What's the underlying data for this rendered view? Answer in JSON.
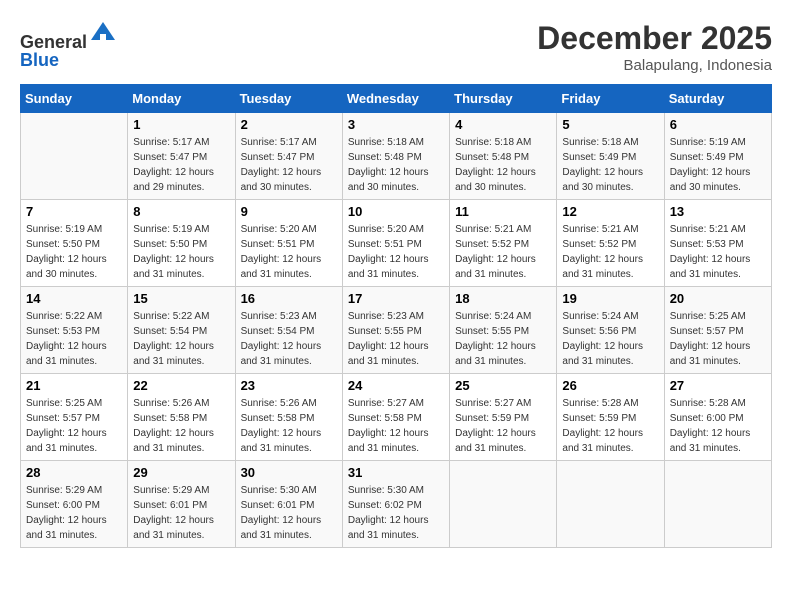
{
  "header": {
    "logo_line1": "General",
    "logo_line2": "Blue",
    "month_title": "December 2025",
    "location": "Balapulang, Indonesia"
  },
  "calendar": {
    "days_of_week": [
      "Sunday",
      "Monday",
      "Tuesday",
      "Wednesday",
      "Thursday",
      "Friday",
      "Saturday"
    ],
    "weeks": [
      [
        {
          "day": "",
          "info": ""
        },
        {
          "day": "1",
          "info": "Sunrise: 5:17 AM\nSunset: 5:47 PM\nDaylight: 12 hours\nand 29 minutes."
        },
        {
          "day": "2",
          "info": "Sunrise: 5:17 AM\nSunset: 5:47 PM\nDaylight: 12 hours\nand 30 minutes."
        },
        {
          "day": "3",
          "info": "Sunrise: 5:18 AM\nSunset: 5:48 PM\nDaylight: 12 hours\nand 30 minutes."
        },
        {
          "day": "4",
          "info": "Sunrise: 5:18 AM\nSunset: 5:48 PM\nDaylight: 12 hours\nand 30 minutes."
        },
        {
          "day": "5",
          "info": "Sunrise: 5:18 AM\nSunset: 5:49 PM\nDaylight: 12 hours\nand 30 minutes."
        },
        {
          "day": "6",
          "info": "Sunrise: 5:19 AM\nSunset: 5:49 PM\nDaylight: 12 hours\nand 30 minutes."
        }
      ],
      [
        {
          "day": "7",
          "info": "Sunrise: 5:19 AM\nSunset: 5:50 PM\nDaylight: 12 hours\nand 30 minutes."
        },
        {
          "day": "8",
          "info": "Sunrise: 5:19 AM\nSunset: 5:50 PM\nDaylight: 12 hours\nand 31 minutes."
        },
        {
          "day": "9",
          "info": "Sunrise: 5:20 AM\nSunset: 5:51 PM\nDaylight: 12 hours\nand 31 minutes."
        },
        {
          "day": "10",
          "info": "Sunrise: 5:20 AM\nSunset: 5:51 PM\nDaylight: 12 hours\nand 31 minutes."
        },
        {
          "day": "11",
          "info": "Sunrise: 5:21 AM\nSunset: 5:52 PM\nDaylight: 12 hours\nand 31 minutes."
        },
        {
          "day": "12",
          "info": "Sunrise: 5:21 AM\nSunset: 5:52 PM\nDaylight: 12 hours\nand 31 minutes."
        },
        {
          "day": "13",
          "info": "Sunrise: 5:21 AM\nSunset: 5:53 PM\nDaylight: 12 hours\nand 31 minutes."
        }
      ],
      [
        {
          "day": "14",
          "info": "Sunrise: 5:22 AM\nSunset: 5:53 PM\nDaylight: 12 hours\nand 31 minutes."
        },
        {
          "day": "15",
          "info": "Sunrise: 5:22 AM\nSunset: 5:54 PM\nDaylight: 12 hours\nand 31 minutes."
        },
        {
          "day": "16",
          "info": "Sunrise: 5:23 AM\nSunset: 5:54 PM\nDaylight: 12 hours\nand 31 minutes."
        },
        {
          "day": "17",
          "info": "Sunrise: 5:23 AM\nSunset: 5:55 PM\nDaylight: 12 hours\nand 31 minutes."
        },
        {
          "day": "18",
          "info": "Sunrise: 5:24 AM\nSunset: 5:55 PM\nDaylight: 12 hours\nand 31 minutes."
        },
        {
          "day": "19",
          "info": "Sunrise: 5:24 AM\nSunset: 5:56 PM\nDaylight: 12 hours\nand 31 minutes."
        },
        {
          "day": "20",
          "info": "Sunrise: 5:25 AM\nSunset: 5:57 PM\nDaylight: 12 hours\nand 31 minutes."
        }
      ],
      [
        {
          "day": "21",
          "info": "Sunrise: 5:25 AM\nSunset: 5:57 PM\nDaylight: 12 hours\nand 31 minutes."
        },
        {
          "day": "22",
          "info": "Sunrise: 5:26 AM\nSunset: 5:58 PM\nDaylight: 12 hours\nand 31 minutes."
        },
        {
          "day": "23",
          "info": "Sunrise: 5:26 AM\nSunset: 5:58 PM\nDaylight: 12 hours\nand 31 minutes."
        },
        {
          "day": "24",
          "info": "Sunrise: 5:27 AM\nSunset: 5:58 PM\nDaylight: 12 hours\nand 31 minutes."
        },
        {
          "day": "25",
          "info": "Sunrise: 5:27 AM\nSunset: 5:59 PM\nDaylight: 12 hours\nand 31 minutes."
        },
        {
          "day": "26",
          "info": "Sunrise: 5:28 AM\nSunset: 5:59 PM\nDaylight: 12 hours\nand 31 minutes."
        },
        {
          "day": "27",
          "info": "Sunrise: 5:28 AM\nSunset: 6:00 PM\nDaylight: 12 hours\nand 31 minutes."
        }
      ],
      [
        {
          "day": "28",
          "info": "Sunrise: 5:29 AM\nSunset: 6:00 PM\nDaylight: 12 hours\nand 31 minutes."
        },
        {
          "day": "29",
          "info": "Sunrise: 5:29 AM\nSunset: 6:01 PM\nDaylight: 12 hours\nand 31 minutes."
        },
        {
          "day": "30",
          "info": "Sunrise: 5:30 AM\nSunset: 6:01 PM\nDaylight: 12 hours\nand 31 minutes."
        },
        {
          "day": "31",
          "info": "Sunrise: 5:30 AM\nSunset: 6:02 PM\nDaylight: 12 hours\nand 31 minutes."
        },
        {
          "day": "",
          "info": ""
        },
        {
          "day": "",
          "info": ""
        },
        {
          "day": "",
          "info": ""
        }
      ]
    ]
  }
}
